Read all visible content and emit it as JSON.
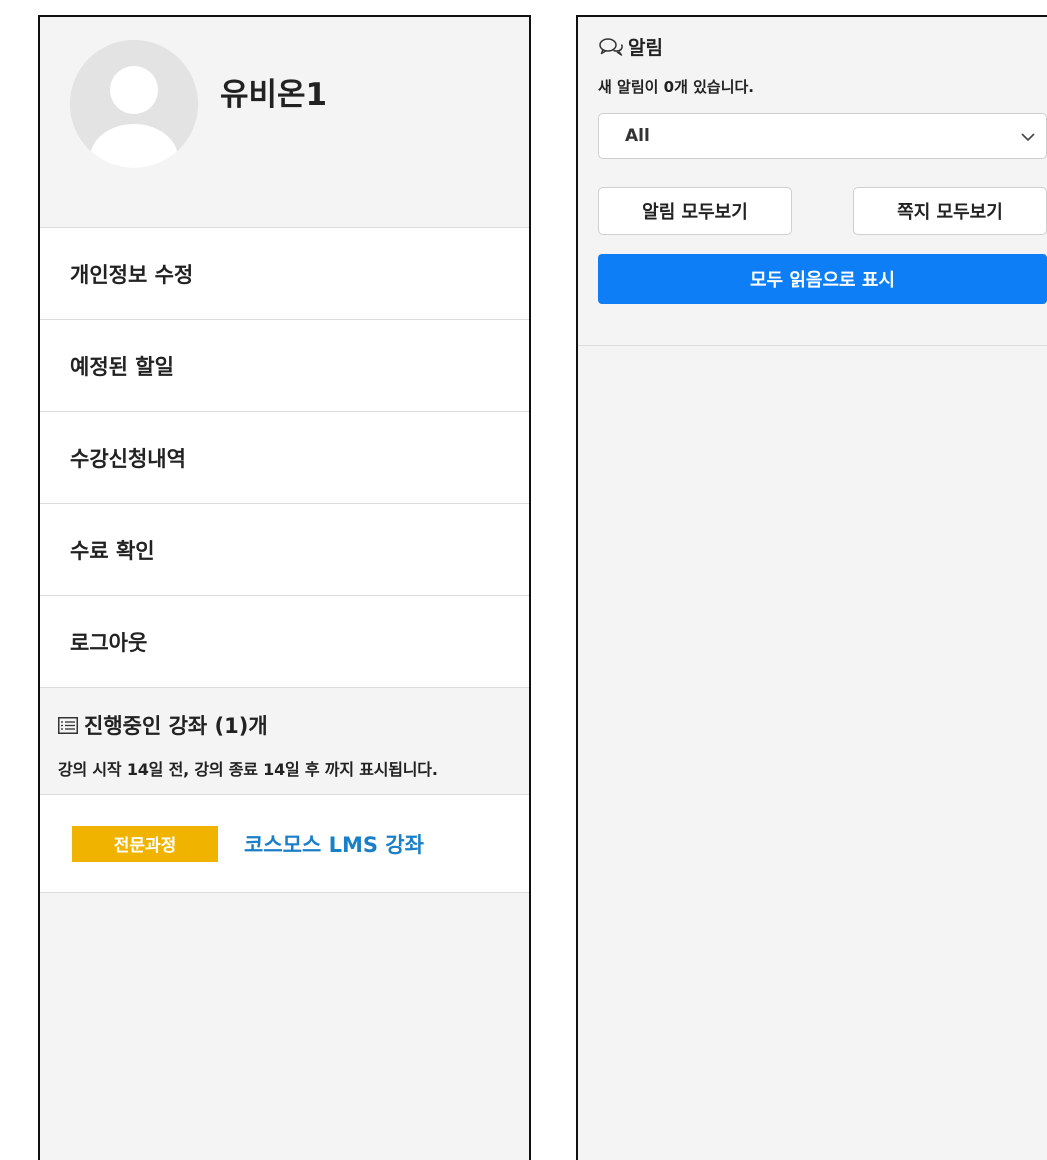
{
  "profile": {
    "name": "유비온1"
  },
  "menu": {
    "items": [
      {
        "label": "개인정보 수정"
      },
      {
        "label": "예정된 할일"
      },
      {
        "label": "수강신청내역"
      },
      {
        "label": "수료 확인"
      },
      {
        "label": "로그아웃"
      }
    ]
  },
  "courses": {
    "title": "진행중인 강좌 (1)개",
    "note": "강의 시작 14일 전, 강의 종료 14일 후 까지 표시됩니다.",
    "items": [
      {
        "badge": "전문과정",
        "name": "코스모스 LMS 강좌"
      }
    ],
    "badge_color": "#f0b400",
    "link_color": "#1b7fc7"
  },
  "notifications": {
    "title": "알림",
    "count_text": "새 알림이 0개 있습니다.",
    "filter": {
      "selected": "All"
    },
    "view_all_label": "알림 모두보기",
    "messages_all_label": "쪽지 모두보기",
    "mark_all_read_label": "모두 읽음으로 표시",
    "primary_color": "#0d7ef5"
  }
}
